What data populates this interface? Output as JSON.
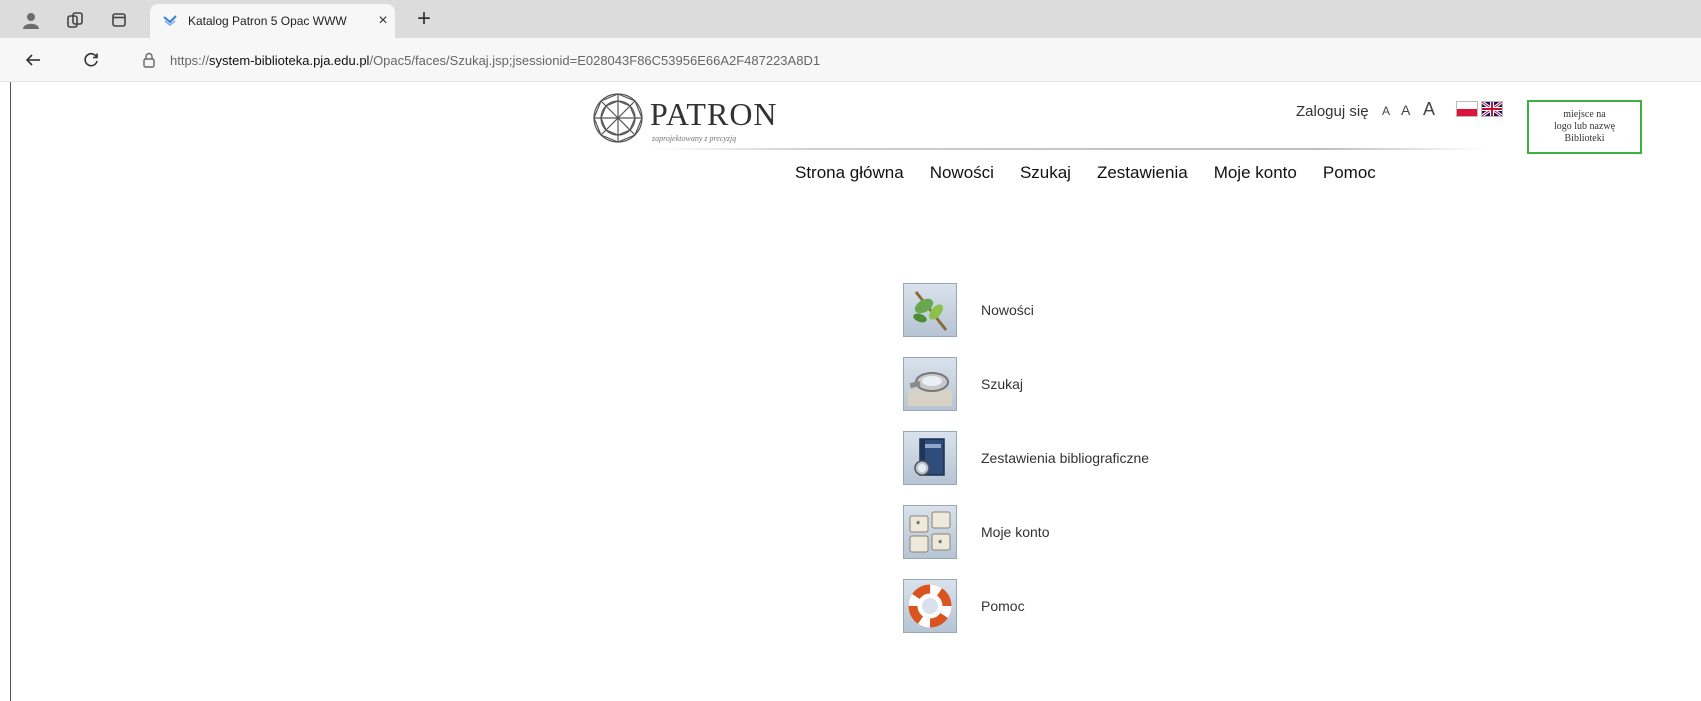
{
  "browser": {
    "tab_title": "Katalog Patron 5 Opac WWW",
    "tab_close": "×",
    "new_tab": "+",
    "url_scheme": "https://",
    "url_host": "system-biblioteka.pja.edu.pl",
    "url_path": "/Opac5/faces/Szukaj.jsp;jsessionid=E028043F86C53956E66A2F487223A8D1"
  },
  "header": {
    "logo_word": "PATRON",
    "logo_tagline": "zaprojektowany z precyzją",
    "login": "Zaloguj się",
    "font_sizes": [
      "A",
      "A",
      "A"
    ],
    "library_box_lines": [
      "miejsce na",
      "logo lub nazwę",
      "Biblioteki"
    ]
  },
  "nav": {
    "items": [
      "Strona główna",
      "Nowości",
      "Szukaj",
      "Zestawienia",
      "Moje konto",
      "Pomoc"
    ]
  },
  "menu": {
    "items": [
      {
        "label": "Nowości",
        "icon": "leaf-icon"
      },
      {
        "label": "Szukaj",
        "icon": "magnifier-icon"
      },
      {
        "label": "Zestawienia bibliograficzne",
        "icon": "book-icon"
      },
      {
        "label": "Moje konto",
        "icon": "keyboard-keys-icon"
      },
      {
        "label": "Pomoc",
        "icon": "lifebuoy-icon"
      }
    ]
  },
  "colors": {
    "library_box_border": "#3cb043",
    "tabbar_bg": "#dcdcdc"
  }
}
